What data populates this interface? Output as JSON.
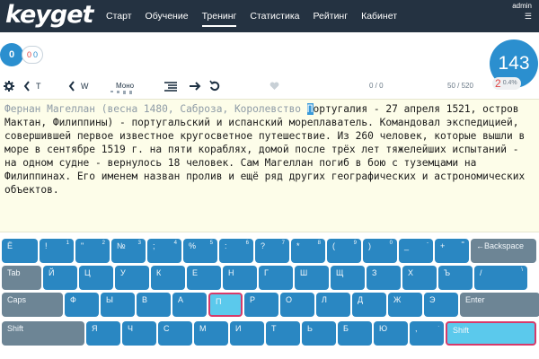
{
  "app": {
    "logo": "keyget",
    "nav": [
      "Старт",
      "Обучение",
      "Тренинг",
      "Статистика",
      "Рейтинг",
      "Кабинет"
    ],
    "active_nav": "Тренинг",
    "user": "admin",
    "user_menu": "☰"
  },
  "stats": {
    "progress_value": "0",
    "errors": "0",
    "correct": "0",
    "speed": "143",
    "mistakes_count": "2",
    "mistakes_percent": "0.4%"
  },
  "toolbar": {
    "t_label": "T",
    "w_label": "W",
    "mono_label": "Моно",
    "font_levels": 4,
    "score": "0 / 0",
    "progress": "50 / 520",
    "icons": [
      "gear-icon",
      "chevron-left-icon",
      "chevron-left-icon",
      "heart-icon",
      "lines-icon",
      "arrow-right-icon",
      "refresh-icon"
    ]
  },
  "text": {
    "typed": "Фернан Магеллан (весна 1480, Саброза, Королевство ",
    "cursor": "П",
    "rest": "ортугалия - 27 апреля 1521, остров Мактан, Филиппины) - португальский и испанский мореплаватель. Командовал экспедицией, совершившей первое известное кругосветное путешествие. Из 260 человек, которые вышли в море в сентябре 1519 г. на пяти кораблях, домой после трёх лет тяжелейших испытаний - на одном судне - вернулось 18 человек. Сам Магеллан погиб в бою с туземцами на Филиппинах. Его именем назван пролив и ещё ряд других географических и астрономических объектов."
  },
  "keyboard": {
    "rows": [
      {
        "keys": [
          {
            "label": "Ё",
            "sub": ""
          },
          {
            "label": "!",
            "sub": "1"
          },
          {
            "label": "\"",
            "sub": "2"
          },
          {
            "label": "№",
            "sub": "3"
          },
          {
            "label": ";",
            "sub": "4"
          },
          {
            "label": "%",
            "sub": "5"
          },
          {
            "label": ":",
            "sub": "6"
          },
          {
            "label": "?",
            "sub": "7"
          },
          {
            "label": "*",
            "sub": "8"
          },
          {
            "label": "(",
            "sub": "9"
          },
          {
            "label": ")",
            "sub": "0"
          },
          {
            "label": "_",
            "sub": "-"
          },
          {
            "label": "+",
            "sub": "="
          },
          {
            "label": "←Backspace",
            "sub": "",
            "special": true
          }
        ]
      },
      {
        "keys": [
          {
            "label": "Tab",
            "sub": "",
            "special": true
          },
          {
            "label": "Й",
            "sub": ""
          },
          {
            "label": "Ц",
            "sub": ""
          },
          {
            "label": "У",
            "sub": ""
          },
          {
            "label": "К",
            "sub": ""
          },
          {
            "label": "Е",
            "sub": ""
          },
          {
            "label": "Н",
            "sub": ""
          },
          {
            "label": "Г",
            "sub": ""
          },
          {
            "label": "Ш",
            "sub": ""
          },
          {
            "label": "Щ",
            "sub": ""
          },
          {
            "label": "З",
            "sub": ""
          },
          {
            "label": "Х",
            "sub": ""
          },
          {
            "label": "Ъ",
            "sub": ""
          },
          {
            "label": "/",
            "sub": "\\"
          }
        ]
      },
      {
        "keys": [
          {
            "label": "Caps",
            "sub": "",
            "special": true
          },
          {
            "label": "Ф",
            "sub": ""
          },
          {
            "label": "Ы",
            "sub": ""
          },
          {
            "label": "В",
            "sub": ""
          },
          {
            "label": "А",
            "sub": ""
          },
          {
            "label": "П",
            "sub": "",
            "highlight": true
          },
          {
            "label": "Р",
            "sub": ""
          },
          {
            "label": "О",
            "sub": ""
          },
          {
            "label": "Л",
            "sub": ""
          },
          {
            "label": "Д",
            "sub": ""
          },
          {
            "label": "Ж",
            "sub": ""
          },
          {
            "label": "Э",
            "sub": ""
          },
          {
            "label": "Enter",
            "sub": "",
            "special": true
          }
        ]
      },
      {
        "keys": [
          {
            "label": "Shift",
            "sub": "",
            "special": true
          },
          {
            "label": "Я",
            "sub": ""
          },
          {
            "label": "Ч",
            "sub": ""
          },
          {
            "label": "С",
            "sub": ""
          },
          {
            "label": "М",
            "sub": ""
          },
          {
            "label": "И",
            "sub": ""
          },
          {
            "label": "Т",
            "sub": ""
          },
          {
            "label": "Ь",
            "sub": ""
          },
          {
            "label": "Б",
            "sub": ""
          },
          {
            "label": "Ю",
            "sub": ""
          },
          {
            "label": ",",
            "sub": "."
          },
          {
            "label": "Shift",
            "sub": "",
            "highlight": true
          }
        ]
      }
    ]
  },
  "colors": {
    "nav_bg": "#243241",
    "accent": "#2b8fcf",
    "key": "#2a87c2",
    "key_special": "#6d8595",
    "key_highlight": "#5bc9ec",
    "highlight_border": "#d63a6a",
    "text_bg": "#fdfde9",
    "error": "#e04444"
  }
}
